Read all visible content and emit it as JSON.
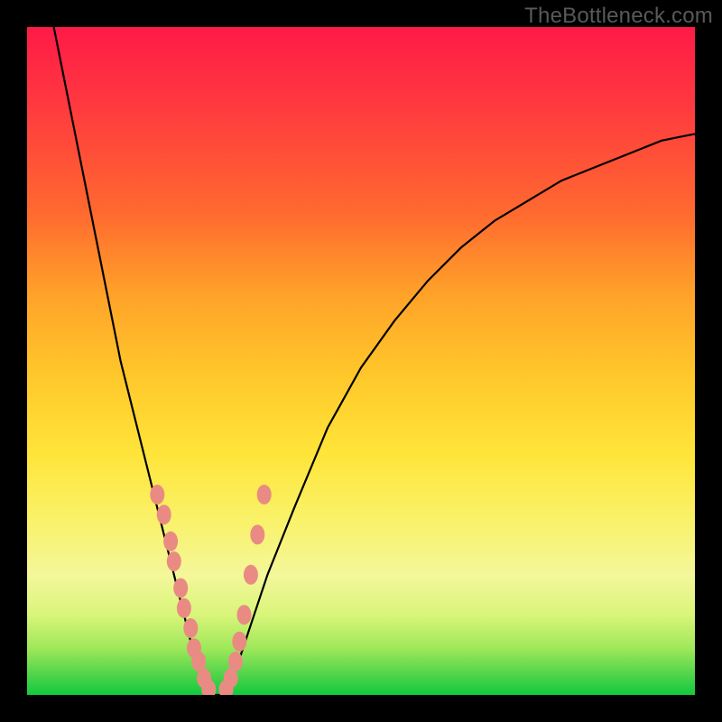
{
  "watermark": "TheBottleneck.com",
  "chart_data": {
    "type": "line",
    "title": "",
    "xlabel": "",
    "ylabel": "",
    "xlim": [
      0,
      100
    ],
    "ylim": [
      0,
      100
    ],
    "grid": false,
    "legend": false,
    "left_curve": {
      "x": [
        4,
        6,
        8,
        10,
        12,
        14,
        16,
        18,
        20,
        22,
        24,
        25,
        26,
        27
      ],
      "y": [
        100,
        90,
        80,
        70,
        60,
        50,
        42,
        34,
        26,
        18,
        10,
        6,
        3,
        0
      ]
    },
    "right_curve": {
      "x": [
        30,
        31,
        32,
        34,
        36,
        40,
        45,
        50,
        55,
        60,
        65,
        70,
        75,
        80,
        85,
        90,
        95,
        100
      ],
      "y": [
        0,
        3,
        6,
        12,
        18,
        28,
        40,
        49,
        56,
        62,
        67,
        71,
        74,
        77,
        79,
        81,
        83,
        84
      ]
    },
    "floor_segment": {
      "x": [
        27,
        30
      ],
      "y": [
        0,
        0
      ]
    },
    "markers_left": {
      "x": [
        19.5,
        20.5,
        21.5,
        22.0,
        23.0,
        23.5,
        24.5,
        25.0,
        25.7,
        26.5,
        27.2
      ],
      "y": [
        30,
        27,
        23,
        20,
        16,
        13,
        10,
        7,
        5,
        2.5,
        0.8
      ]
    },
    "markers_right": {
      "x": [
        29.8,
        30.5,
        31.2,
        31.8,
        32.5,
        33.5,
        34.5,
        35.5
      ],
      "y": [
        0.8,
        2.5,
        5,
        8,
        12,
        18,
        24,
        30
      ]
    }
  }
}
